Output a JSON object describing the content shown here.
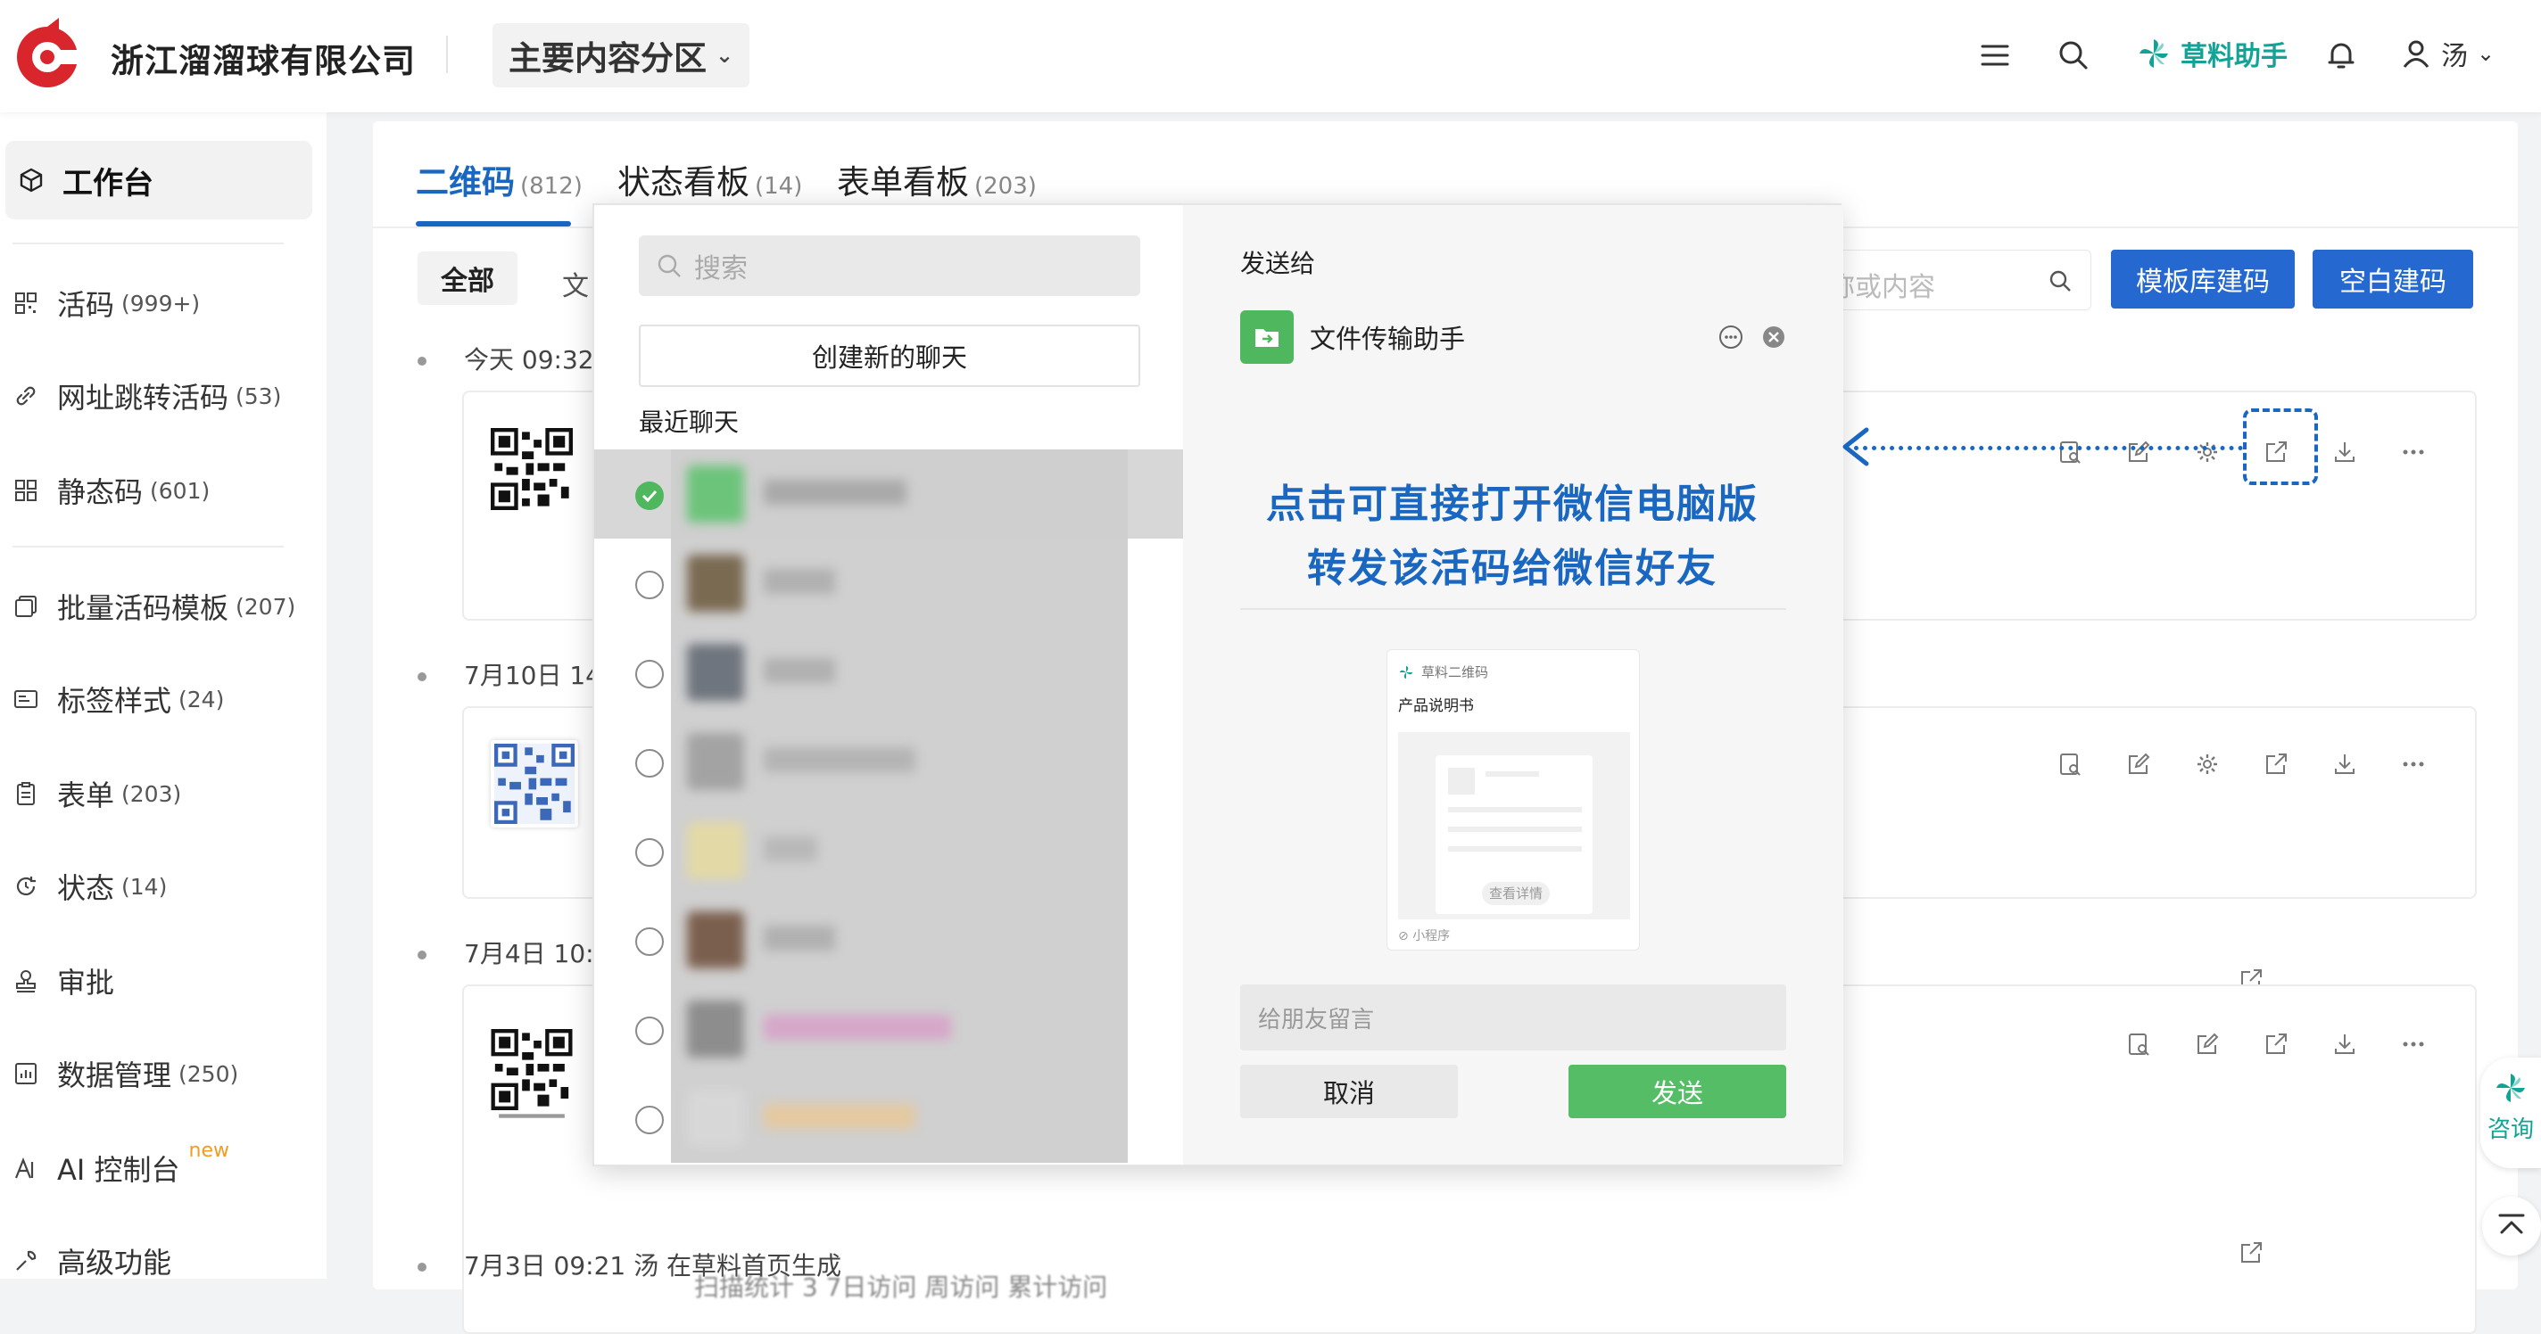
{
  "header": {
    "company": "浙江溜溜球有限公司",
    "zone": "主要内容分区",
    "brand_assistant": "草料助手",
    "user_initial": "汤"
  },
  "sidebar": {
    "items": [
      {
        "label": "工作台",
        "count": ""
      },
      {
        "label": "活码",
        "count": "(999+)"
      },
      {
        "label": "网址跳转活码",
        "count": "(53)"
      },
      {
        "label": "静态码",
        "count": "(601)"
      },
      {
        "label": "批量活码模板",
        "count": "(207)"
      },
      {
        "label": "标签样式",
        "count": "(24)"
      },
      {
        "label": "表单",
        "count": "(203)"
      },
      {
        "label": "状态",
        "count": "(14)"
      },
      {
        "label": "审批",
        "count": ""
      },
      {
        "label": "数据管理",
        "count": "(250)"
      },
      {
        "label": "AI 控制台",
        "count": "",
        "badge": "new"
      },
      {
        "label": "高级功能",
        "count": ""
      }
    ]
  },
  "main": {
    "tabs": [
      {
        "label": "二维码",
        "count": "(812)"
      },
      {
        "label": "状态看板",
        "count": "(14)"
      },
      {
        "label": "表单看板",
        "count": "(203)"
      }
    ],
    "filters": {
      "all": "全部",
      "doc": "文"
    },
    "search_placeholder": "名称或内容",
    "btn_template": "模板库建码",
    "btn_blank": "空白建码",
    "dates": [
      "今天 09:32",
      "7月10日 14",
      "7月4日 10:",
      "7月3日 09:21  汤  在草料首页生成"
    ],
    "blur_text": "扫描统计 3  7日访问  周访问  累计访问"
  },
  "share_modal": {
    "search_placeholder": "搜索",
    "new_chat": "创建新的聊天",
    "recent_label": "最近聊天",
    "send_to_label": "发送给",
    "target_name": "文件传输助手",
    "promo_line1": "点击可直接打开微信电脑版",
    "promo_line2": "转发该活码给微信好友",
    "mini_program": {
      "brand": "草料二维码",
      "title": "产品说明书",
      "button": "查看详情",
      "footer": "小程序"
    },
    "message_placeholder": "给朋友留言",
    "cancel": "取消",
    "send": "发送"
  },
  "float": {
    "consult": "咨询"
  },
  "colors": {
    "primary": "#1a67c2",
    "wechat_green": "#54bd66",
    "brand_teal": "#12a396"
  }
}
